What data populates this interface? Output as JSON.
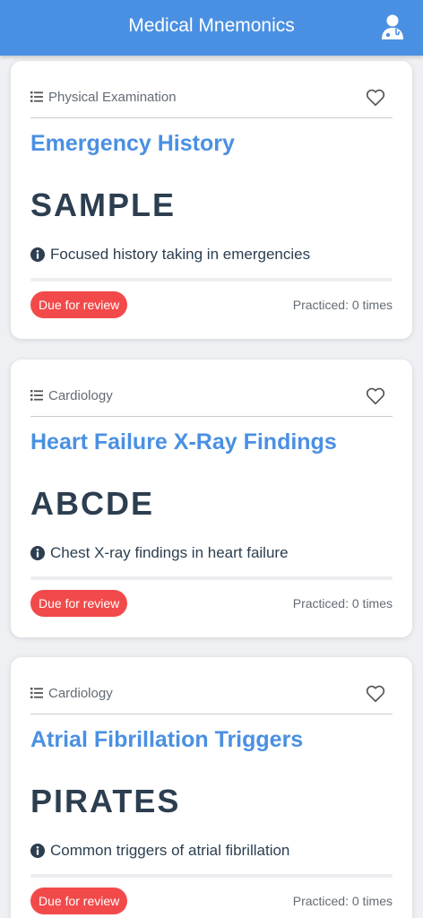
{
  "header": {
    "title": "Medical Mnemonics",
    "profile_icon": "doctor-icon"
  },
  "colors": {
    "primary": "#4a90e2",
    "mnemonic_text": "#2c3e50",
    "badge": "#f24a4a",
    "muted_text": "#636b74"
  },
  "cards": [
    {
      "category": "Physical Examination",
      "title": "Emergency History",
      "mnemonic": "SAMPLE",
      "description": "Focused history taking in emergencies",
      "badge": "Due for review",
      "practiced": "Practiced: 0 times",
      "progress": 0,
      "favorite": false
    },
    {
      "category": "Cardiology",
      "title": "Heart Failure X-Ray Findings",
      "mnemonic": "ABCDE",
      "description": "Chest X-ray findings in heart failure",
      "badge": "Due for review",
      "practiced": "Practiced: 0 times",
      "progress": 0,
      "favorite": false
    },
    {
      "category": "Cardiology",
      "title": "Atrial Fibrillation Triggers",
      "mnemonic": "PIRATES",
      "description": "Common triggers of atrial fibrillation",
      "badge": "Due for review",
      "practiced": "Practiced: 0 times",
      "progress": 0,
      "favorite": false
    }
  ]
}
